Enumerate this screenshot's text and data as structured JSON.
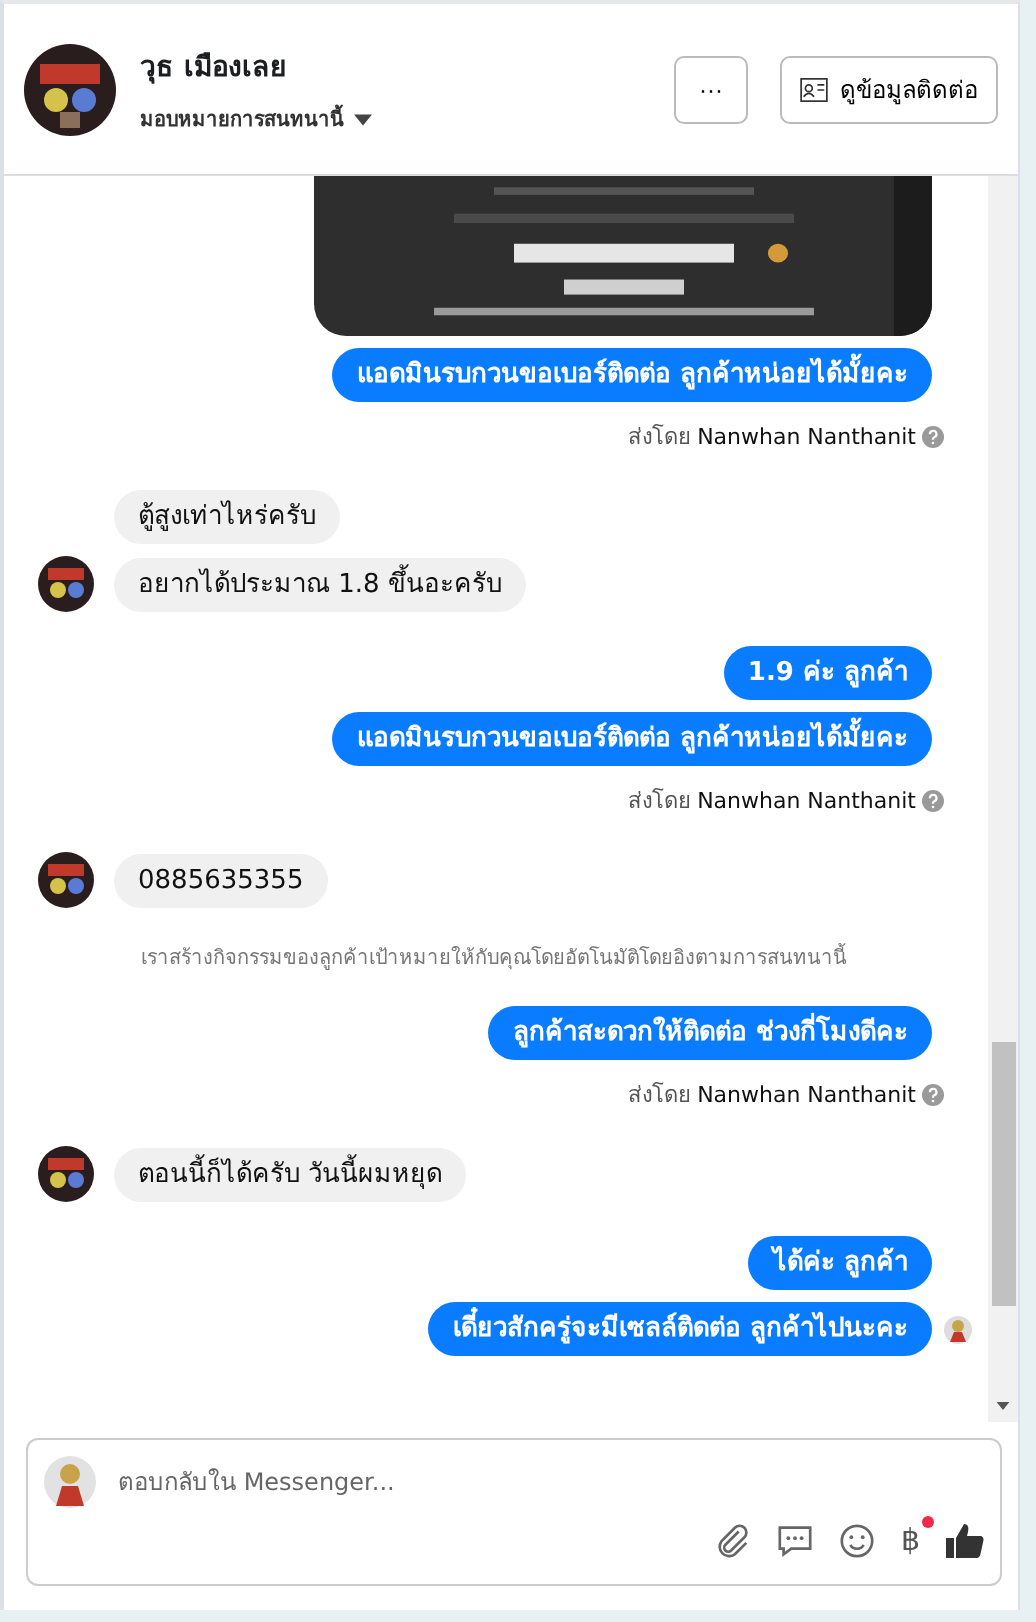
{
  "header": {
    "name": "วุธ เมืองเลย",
    "assign": "มอบหมายการสนทนานี้",
    "more_button": "···",
    "contact_button": "ดูข้อมูลติดต่อ"
  },
  "messages": [
    {
      "kind": "picture"
    },
    {
      "kind": "out",
      "text": "แอดมินรบกวนขอเบอร์ติดต่อ ลูกค้าหน่อยได้มั้ยคะ"
    },
    {
      "kind": "sent_by",
      "prefix": "ส่งโดย",
      "name": "Nanwhan Nanthanit"
    },
    {
      "kind": "in",
      "text": "ตู้สูงเท่าไหร่ครับ",
      "avatar": false
    },
    {
      "kind": "in",
      "text": "อยากได้ประมาณ 1.8 ขึ้นอะครับ",
      "avatar": true
    },
    {
      "kind": "out",
      "text": "1.9 ค่ะ ลูกค้า"
    },
    {
      "kind": "out",
      "text": "แอดมินรบกวนขอเบอร์ติดต่อ ลูกค้าหน่อยได้มั้ยคะ"
    },
    {
      "kind": "sent_by",
      "prefix": "ส่งโดย",
      "name": "Nanwhan Nanthanit"
    },
    {
      "kind": "in",
      "text": "0885635355",
      "avatar": true
    },
    {
      "kind": "notice",
      "text": "เราสร้างกิจกรรมของลูกค้าเป้าหมายให้กับคุณโดยอัตโนมัติโดยอิงตามการสนทนานี้"
    },
    {
      "kind": "out",
      "text": "ลูกค้าสะดวกให้ติดต่อ ช่วงกี่โมงดีคะ"
    },
    {
      "kind": "sent_by",
      "prefix": "ส่งโดย",
      "name": "Nanwhan Nanthanit"
    },
    {
      "kind": "in",
      "text": "ตอนนี้ก็ได้ครับ วันนี้ผมหยุด",
      "avatar": true
    },
    {
      "kind": "out",
      "text": "ได้ค่ะ ลูกค้า",
      "seen": false
    },
    {
      "kind": "out",
      "text": "เดี๋ยวสักครู่จะมีเซลล์ติดต่อ ลูกค้าไปนะคะ",
      "seen": true
    }
  ],
  "composer": {
    "placeholder": "ตอบกลับใน Messenger...",
    "currency_symbol": "฿",
    "currency_notification": true
  }
}
